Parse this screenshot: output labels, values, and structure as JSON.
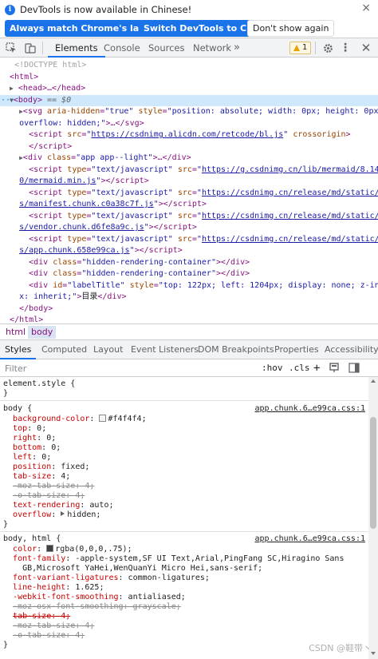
{
  "banner": {
    "message": "DevTools is now available in Chinese!",
    "btn_match": "Always match Chrome's language",
    "btn_switch": "Switch DevTools to Chinese",
    "btn_dismiss": "Don't show again",
    "close": "×"
  },
  "toolbar": {
    "tabs": [
      "Elements",
      "Console",
      "Sources",
      "Network"
    ],
    "more": "»",
    "issues_count": "1"
  },
  "tree": {
    "doctype": "<!DOCTYPE html>",
    "html_open": "<html>",
    "head": "<head>…</head>",
    "body_sel": "<body> == $0",
    "svg1": "<svg aria-hidden=\"true\" style=\"position: absolute; width: 0px; height: 0px;",
    "svg2": "overflow: hidden;\">…</svg>",
    "script1_src": "https://csdnimg.alicdn.com/retcode/bl.js",
    "div_app": "app app--light",
    "mermaid_src_1": "https://g.csdnimg.cn/lib/mermaid/8.14.",
    "mermaid_src_2": "0/mermaid.min.js",
    "manifest_src": "https://csdnimg.cn/release/md/static/js/manifest.chunk.c0a38c7f.js",
    "vendor_src_1": "https://csdnimg.cn/release/md/static/j",
    "vendor_src_2": "s/vendor.chunk.d6fe8a9c.js",
    "app_src_1": "https://csdnimg.cn/release/md/static/j",
    "app_src_2": "s/app.chunk.658e99ca.js",
    "hidden_class": "hidden-rendering-container",
    "label_id": "labelTitle",
    "label_style_1": "top: 122px; left: 1204px; display: none; z-inde",
    "label_style_2": "x: inherit;",
    "label_text": "目录"
  },
  "breadcrumbs": [
    "html",
    "body"
  ],
  "sidebar_tabs": [
    "Styles",
    "Computed",
    "Layout",
    "Event Listeners",
    "DOM Breakpoints",
    "Properties",
    "Accessibility"
  ],
  "filter": {
    "placeholder": "Filter",
    "hov": ":hov",
    "cls": ".cls",
    "plus": "+"
  },
  "styles": {
    "element_style": "element.style {",
    "body_selector": "body {",
    "body_source": "app.chunk.6…e99ca.css:1",
    "body_bg_prop": "background-color",
    "body_bg_val": "#f4f4f4",
    "body_bg_color": "#f4f4f4",
    "top": "0",
    "right": "0",
    "bottom": "0",
    "left": "0",
    "position": "fixed",
    "tab_size": "4",
    "moz_tab": "-moz-tab-size: 4;",
    "o_tab": "-o-tab-size: 4;",
    "text_rendering": "auto",
    "overflow": "hidden",
    "html_body_selector": "body, html {",
    "html_body_source": "app.chunk.6…e99ca.css:1",
    "color_val": "rgba(0,0,0,.75)",
    "color_swatch": "#404040",
    "font_family_1": "-apple-system,SF UI Text,Arial,PingFang SC,Hiragino Sans",
    "font_family_2": "GB,Microsoft YaHei,WenQuanYi Micro Hei,sans-serif",
    "font_variant": "common-ligatures",
    "line_height": "1.625",
    "webkit_smoothing": "antialiased",
    "moz_smoothing": "-moz-osx-font-smoothing: grayscale;",
    "tab_size_strike": "tab-size: 4;",
    "moz_tab_2": "-moz-tab-size: 4;",
    "o_tab_2": "-o-tab-size: 4;"
  },
  "watermark": "CSDN @鞋带丶"
}
